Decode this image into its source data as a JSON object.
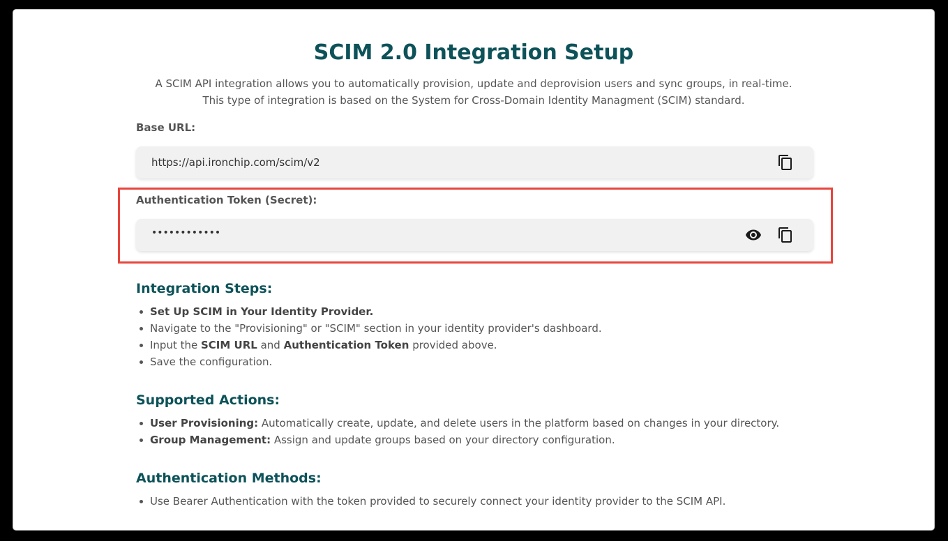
{
  "header": {
    "title": "SCIM 2.0 Integration Setup",
    "description_line1": "A SCIM API integration allows you to automatically provision, update and deprovision users and sync groups, in real-time.",
    "description_line2": "This type of integration is based on the System for Cross-Domain Identity Managment (SCIM) standard."
  },
  "base_url": {
    "label": "Base URL:",
    "value": "https://api.ironchip.com/scim/v2",
    "copy_icon": "copy-icon"
  },
  "auth_token": {
    "label": "Authentication Token (Secret):",
    "value": "••••••••••••",
    "reveal_icon": "eye-icon",
    "copy_icon": "copy-icon"
  },
  "highlight_color": "#e8453c",
  "accent_color": "#0d5259",
  "integration_steps": {
    "title": "Integration Steps:",
    "step1_bold": "Set Up SCIM in Your Identity Provider.",
    "step2": "Navigate to the \"Provisioning\" or \"SCIM\" section in your identity provider's dashboard.",
    "step3_pre": "Input the ",
    "step3_bold1": "SCIM URL",
    "step3_mid": " and ",
    "step3_bold2": "Authentication Token",
    "step3_post": " provided above.",
    "step4": "Save the configuration."
  },
  "supported_actions": {
    "title": "Supported Actions:",
    "item1_bold": "User Provisioning:",
    "item1_text": " Automatically create, update, and delete users in the platform based on changes in your directory.",
    "item2_bold": "Group Management:",
    "item2_text": " Assign and update groups based on your directory configuration."
  },
  "auth_methods": {
    "title": "Authentication Methods:",
    "item1": "Use Bearer Authentication with the token provided to securely connect your identity provider to the SCIM API."
  }
}
